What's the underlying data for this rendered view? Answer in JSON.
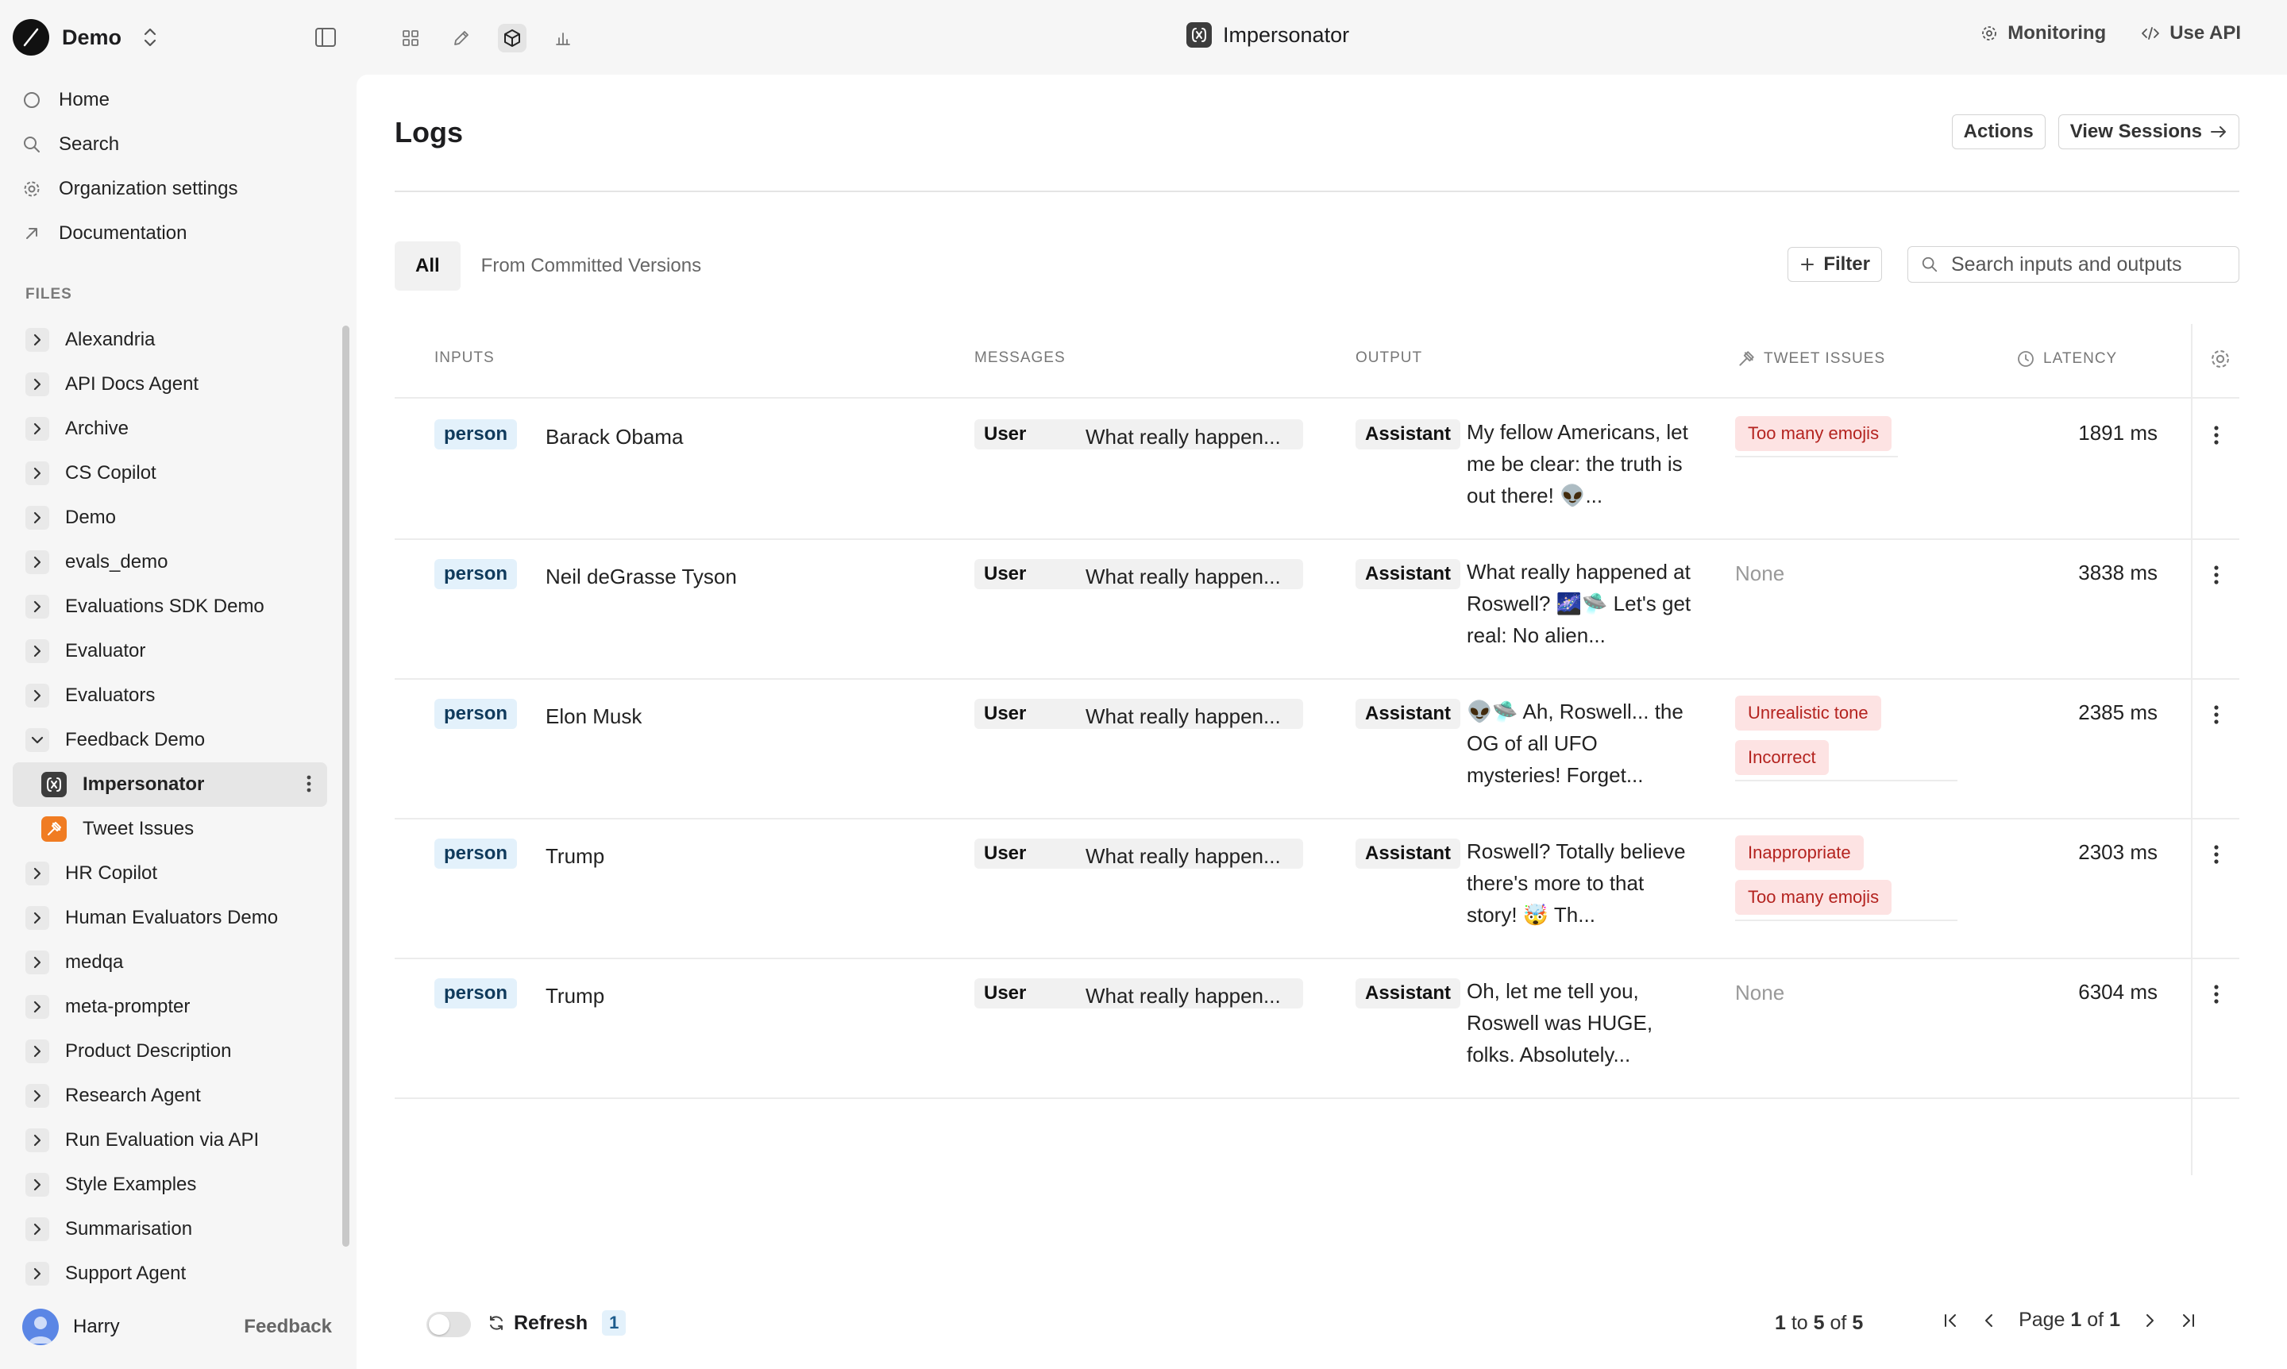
{
  "workspace": {
    "name": "Demo"
  },
  "nav": [
    {
      "label": "Home",
      "icon": "circle-icon"
    },
    {
      "label": "Search",
      "icon": "search-icon"
    },
    {
      "label": "Organization settings",
      "icon": "gear-icon"
    },
    {
      "label": "Documentation",
      "icon": "arrow-up-right-icon"
    }
  ],
  "files_label": "FILES",
  "files": [
    "Alexandria",
    "API Docs Agent",
    "Archive",
    "CS Copilot",
    "Demo",
    "evals_demo",
    "Evaluations SDK Demo",
    "Evaluator",
    "Evaluators",
    "Feedback Demo",
    "Impersonator",
    "Tweet Issues",
    "HR Copilot",
    "Human Evaluators Demo",
    "medqa",
    "meta-prompter",
    "Product Description",
    "Research Agent",
    "Run Evaluation via API",
    "Style Examples",
    "Summarisation",
    "Support Agent"
  ],
  "user": {
    "name": "Harry",
    "feedback": "Feedback"
  },
  "topbar": {
    "title": "Impersonator",
    "monitoring": "Monitoring",
    "use_api": "Use API"
  },
  "page": {
    "title": "Logs",
    "actions_label": "Actions",
    "view_sessions_label": "View Sessions",
    "tabs": [
      "All",
      "From Committed Versions"
    ],
    "filter_label": "Filter",
    "search_placeholder": "Search inputs and outputs"
  },
  "table": {
    "headers": {
      "inputs": "INPUTS",
      "messages": "MESSAGES",
      "output": "OUTPUT",
      "tweet_issues": "TWEET ISSUES",
      "latency": "LATENCY"
    },
    "rows": [
      {
        "input_tag": "person",
        "input_value": "Barack Obama",
        "msg_role": "User",
        "msg_text": "What really happen...",
        "out_role": "Assistant",
        "out_text": "My fellow Americans, let me be clear: the truth is out there! 👽...",
        "issues": [
          "Too many emojis"
        ],
        "latency": "1891 ms"
      },
      {
        "input_tag": "person",
        "input_value": "Neil deGrasse Tyson",
        "msg_role": "User",
        "msg_text": "What really happen...",
        "out_role": "Assistant",
        "out_text": "What really happened at Roswell? 🌌🛸 Let's get real: No alien...",
        "issues": [],
        "latency": "3838 ms"
      },
      {
        "input_tag": "person",
        "input_value": "Elon Musk",
        "msg_role": "User",
        "msg_text": "What really happen...",
        "out_role": "Assistant",
        "out_text": "👽🛸 Ah, Roswell... the OG of all UFO mysteries! Forget...",
        "issues": [
          "Unrealistic tone",
          "Incorrect"
        ],
        "latency": "2385 ms"
      },
      {
        "input_tag": "person",
        "input_value": "Trump",
        "msg_role": "User",
        "msg_text": "What really happen...",
        "out_role": "Assistant",
        "out_text": "Roswell? Totally believe there's more to that story! 🤯 Th...",
        "issues": [
          "Inappropriate",
          "Too many emojis"
        ],
        "latency": "2303 ms"
      },
      {
        "input_tag": "person",
        "input_value": "Trump",
        "msg_role": "User",
        "msg_text": "What really happen...",
        "out_role": "Assistant",
        "out_text": "Oh, let me tell you, Roswell was HUGE, folks. Absolutely...",
        "issues": [],
        "latency": "6304 ms"
      }
    ],
    "none_label": "None"
  },
  "footer": {
    "refresh_label": "Refresh",
    "refresh_count": "1",
    "range": {
      "from": "1",
      "to": "5",
      "of_label": "of",
      "to_label": "to",
      "total": "5"
    },
    "page": {
      "label": "Page",
      "current": "1",
      "of_label": "of",
      "total": "1"
    }
  },
  "colors": {
    "issue_bg": "#fde3e3",
    "issue_text": "#b4231f",
    "person_bg": "#e3f1fb",
    "tweet_issues_icon": "#f07c22"
  }
}
